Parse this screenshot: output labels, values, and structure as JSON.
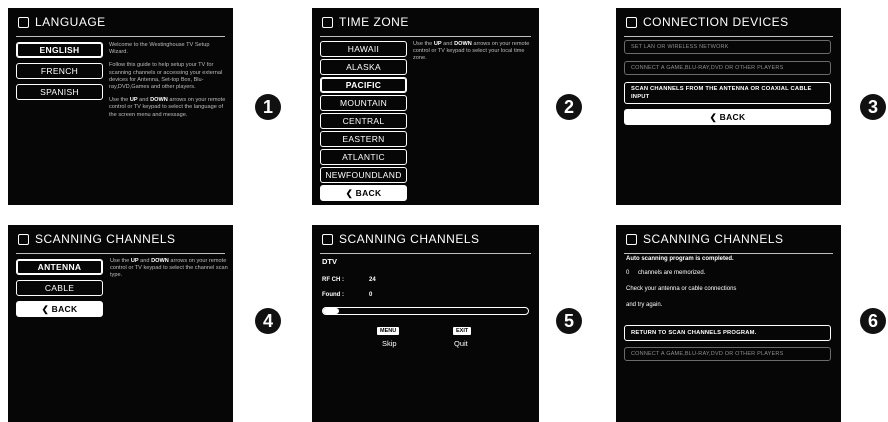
{
  "steps": [
    "1",
    "2",
    "3",
    "4",
    "5",
    "6"
  ],
  "screen1": {
    "title": "LANGUAGE",
    "options": [
      "ENGLISH",
      "FRENCH",
      "SPANISH"
    ],
    "desc_welcome": "Welcome to the  Westinghouse TV Setup Wizard.",
    "desc_guide": "Follow this guide to help setup your TV for scanning channels or accessing your external devices for Antenna, Set-top Box, Blu-ray,DVD,Games and other players.",
    "desc_use_a": "Use the ",
    "up": "UP",
    "and": " and ",
    "down": "DOWN",
    "desc_use_b": " arrows on your remote control or TV keypad to select the language of the screen menu and message."
  },
  "screen2": {
    "title": "TIME ZONE",
    "zones": [
      "HAWAII",
      "ALASKA",
      "PACIFIC",
      "MOUNTAIN",
      "CENTRAL",
      "EASTERN",
      "ATLANTIC",
      "NEWFOUNDLAND"
    ],
    "back": "BACK",
    "desc_a": "Use the ",
    "up": "UP",
    "and": " and ",
    "down": "DOWN",
    "desc_b": " arrows on your remote control or TV keypad to select your local time zone."
  },
  "screen3": {
    "title": "CONNECTION DEVICES",
    "rows": [
      "SET LAN OR WIRELESS NETWORK",
      "CONNECT A GAME,BLU-RAY,DVD OR OTHER PLAYERS"
    ],
    "highlight": "SCAN CHANNELS FROM THE ANTENNA OR COAXIAL CABLE INPUT",
    "back": "BACK"
  },
  "screen4": {
    "title": "SCANNING CHANNELS",
    "options": [
      "ANTENNA",
      "CABLE"
    ],
    "back": "BACK",
    "desc_a": "Use the ",
    "up": "UP",
    "and": " and ",
    "down": "DOWN",
    "desc_b": " arrows on your remote control or TV keypad to select the channel scan type."
  },
  "screen5": {
    "title": "SCANNING CHANNELS",
    "mode": "DTV",
    "rf_label": "RF CH :",
    "rf_value": "24",
    "found_label": "Found :",
    "found_value": "0",
    "progress": 0.08,
    "menu_key": "MENU",
    "menu_label": "Skip",
    "exit_key": "EXIT",
    "exit_label": "Quit"
  },
  "screen6": {
    "title": "SCANNING CHANNELS",
    "line1": "Auto scanning program is completed.",
    "line2_num": "0",
    "line2_text": "channels are memorized.",
    "line3": "Check your antenna or cable connections",
    "line4": "and try again.",
    "highlight": "RETURN TO SCAN CHANNELS PROGRAM.",
    "row": "CONNECT A GAME,BLU-RAY,DVD OR OTHER PLAYERS"
  }
}
